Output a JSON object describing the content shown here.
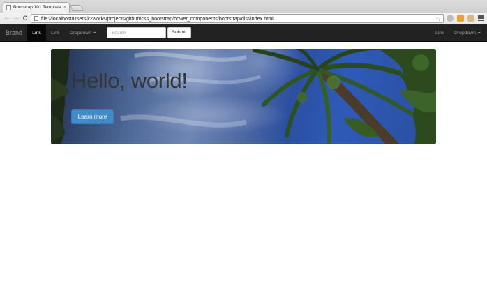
{
  "browser": {
    "tab_title": "Bootstrap 101 Template",
    "tab_close": "×",
    "url": "file://localhost/Users/k2works/projects/github/css_bootstrap/bower_components/bootstrap/dist/index.html",
    "back_glyph": "←",
    "forward_glyph": "→",
    "reload_glyph": "C",
    "star_glyph": "☆"
  },
  "navbar": {
    "brand": "Brand",
    "left_links": [
      {
        "label": "Link",
        "active": true
      },
      {
        "label": "Link",
        "active": false
      },
      {
        "label": "Dropdown",
        "active": false
      }
    ],
    "search_placeholder": "Search",
    "submit_label": "Submit",
    "right_links": [
      {
        "label": "Link"
      },
      {
        "label": "Dropdown"
      }
    ]
  },
  "jumbotron": {
    "heading": "Hello, world!",
    "button_label": "Learn more"
  },
  "colors": {
    "navbar_bg": "#222222",
    "primary_button": "#428bca",
    "sky": "#2e5ab7"
  }
}
